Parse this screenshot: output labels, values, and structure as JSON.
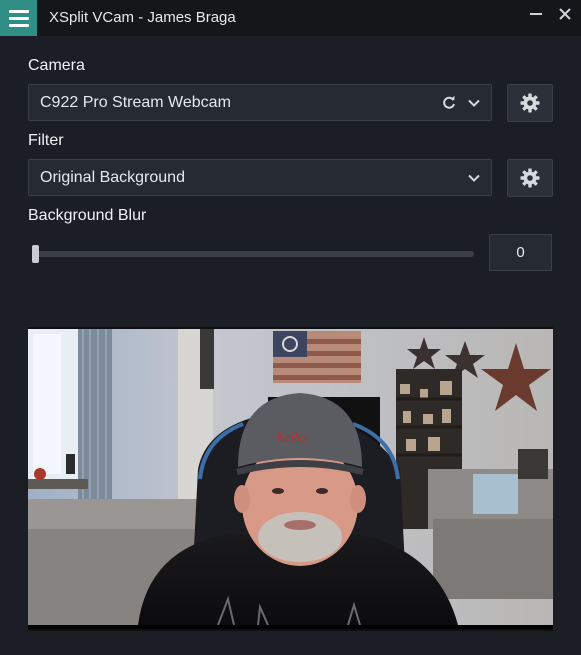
{
  "window": {
    "title": "XSplit VCam - James Braga"
  },
  "camera": {
    "label": "Camera",
    "selected": "C922 Pro Stream Webcam",
    "icons": [
      "refresh-icon",
      "chevron-down-icon",
      "gear-icon"
    ]
  },
  "filter": {
    "label": "Filter",
    "selected": "Original Background",
    "icons": [
      "chevron-down-icon",
      "gear-icon"
    ]
  },
  "blur": {
    "label": "Background Blur",
    "value": "0"
  },
  "colors": {
    "accent": "#2f8f85",
    "background": "#1b1e24",
    "titlebar": "#14161a"
  }
}
